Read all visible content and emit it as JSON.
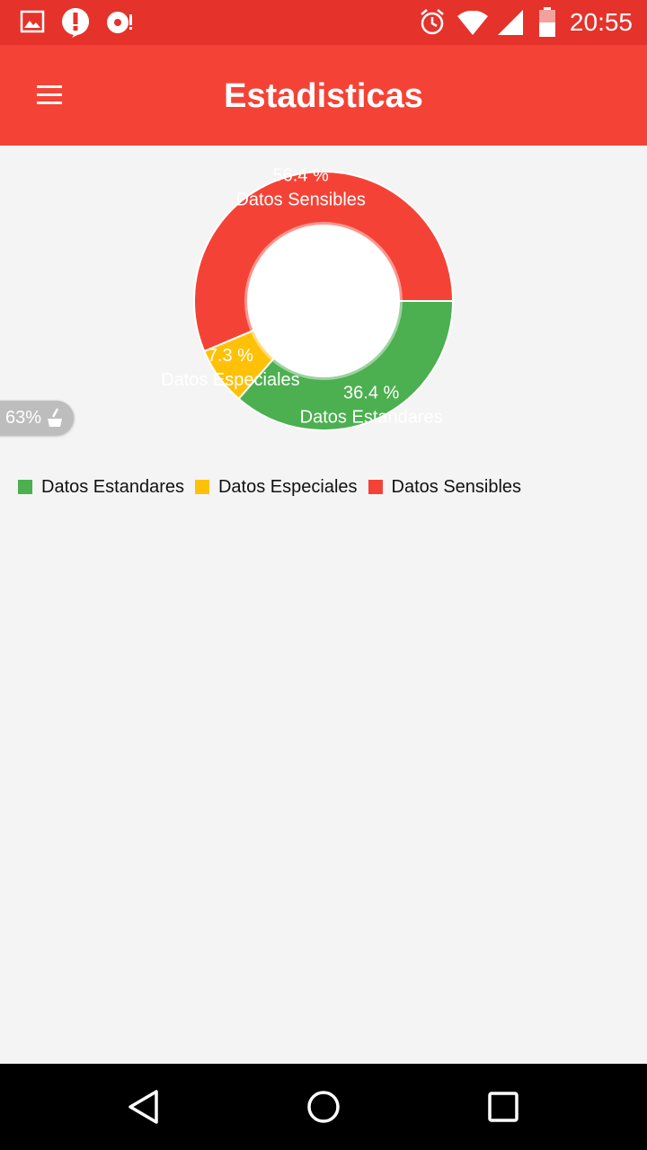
{
  "status_bar": {
    "time": "20:55",
    "left_icons": [
      "image-icon",
      "alert-icon",
      "record-icon"
    ],
    "right_icons": [
      "alarm-icon",
      "wifi-icon",
      "signal-icon",
      "battery-icon"
    ],
    "color": "#e5322a"
  },
  "app_bar": {
    "title": "Estadisticas",
    "color": "#f44336"
  },
  "chart_data": {
    "type": "pie",
    "donut": true,
    "categories": [
      "Datos Estandares",
      "Datos Especiales",
      "Datos Sensibles"
    ],
    "values": [
      36.4,
      7.3,
      56.4
    ],
    "value_labels": [
      "36.4 %",
      "7.3 %",
      "56.4 %"
    ],
    "colors": [
      "#4caf50",
      "#ffc107",
      "#f44336"
    ],
    "legend_position": "bottom-left"
  },
  "floating_badge": {
    "label": "63%"
  },
  "nav_bar": {
    "buttons": [
      "back-icon",
      "home-icon",
      "recents-icon"
    ]
  }
}
